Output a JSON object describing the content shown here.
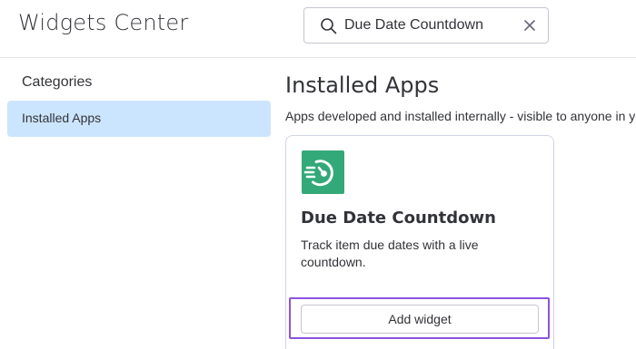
{
  "header": {
    "title": "Widgets Center"
  },
  "search": {
    "value": "Due Date Countdown",
    "icon": "search-icon",
    "clear_icon": "close-icon"
  },
  "sidebar": {
    "heading": "Categories",
    "items": [
      {
        "label": "Installed Apps",
        "selected": true
      }
    ]
  },
  "main": {
    "section_title": "Installed Apps",
    "section_description": "Apps developed and installed internally - visible to anyone in your account",
    "cards": [
      {
        "icon": "countdown-clock-icon",
        "title": "Due Date Countdown",
        "description": "Track item due dates with a live countdown.",
        "button_label": "Add widget"
      }
    ]
  },
  "colors": {
    "selected_bg": "#cce5ff",
    "icon_bg": "#33a878",
    "focus_ring": "#8b53e0",
    "text": "#323338",
    "border": "#c5c7d0"
  }
}
